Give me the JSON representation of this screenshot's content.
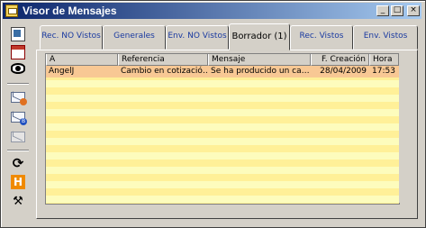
{
  "window": {
    "title": "Visor de Mensajes"
  },
  "titlebar": {
    "min": "_",
    "max": "□",
    "close": "×"
  },
  "toolbar": {
    "refresh_glyph": "⟳",
    "h_glyph": "H",
    "tools_glyph": "⚒",
    "mail2_badge": "B",
    "mail1_badge": ""
  },
  "tabs": [
    {
      "label": "Rec. NO Vistos"
    },
    {
      "label": "Generales"
    },
    {
      "label": "Env. NO Vistos"
    },
    {
      "label": "Borrador (1)"
    },
    {
      "label": "Rec. Vistos"
    },
    {
      "label": "Env. Vistos"
    }
  ],
  "active_tab": "Borrador (1)",
  "table": {
    "columns": [
      "A",
      "Referencia",
      "Mensaje",
      "F. Creación",
      "Hora"
    ],
    "rows": [
      {
        "a": "AngelJ",
        "referencia": "Cambio en cotizació…",
        "mensaje": "Se ha producido un ca…",
        "fecha": "28/04/2009",
        "hora": "17:53"
      }
    ]
  },
  "colors": {
    "selected_row": "#f8c894",
    "stripe_a": "#fdfcbd",
    "stripe_b": "#fff098",
    "title_start": "#0a246a",
    "title_end": "#a6caf0"
  }
}
